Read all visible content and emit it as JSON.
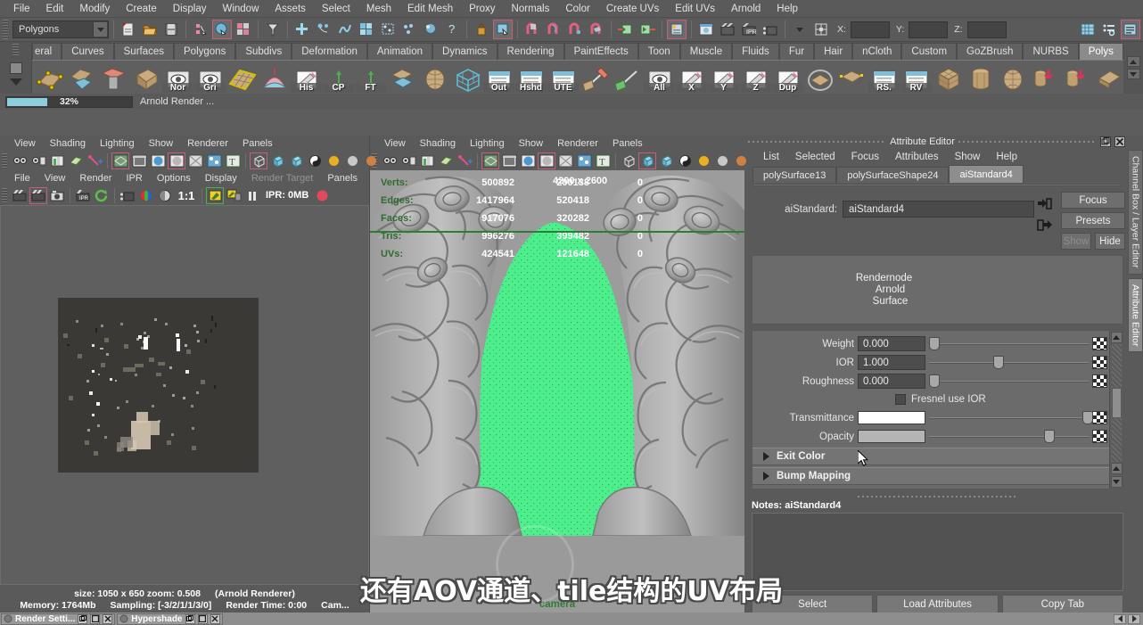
{
  "menubar": {
    "items": [
      "File",
      "Edit",
      "Modify",
      "Create",
      "Display",
      "Window",
      "Assets",
      "Select",
      "Mesh",
      "Edit Mesh",
      "Proxy",
      "Normals",
      "Color",
      "Create UVs",
      "Edit UVs",
      "Arnold",
      "Help"
    ]
  },
  "statusline": {
    "menuset": "Polygons",
    "coord_labels": [
      "X:",
      "Y:",
      "Z:"
    ],
    "coord_values": [
      "",
      "",
      ""
    ],
    "icons": [
      "new-scene-icon",
      "open-scene-icon",
      "save-scene-icon",
      "select-by-hierarchy-icon",
      "select-by-object-icon",
      "select-by-component-icon",
      "select-mask-icon",
      "snap-grid-icon",
      "snap-curve-icon",
      "snap-point-icon",
      "snap-view-plane-icon",
      "snap-projected-icon",
      "construction-plane-icon",
      "question-icon",
      "lock-icon",
      "highlight-selection-icon",
      "magnet-grid-icon",
      "magnet-curve-icon",
      "magnet-point-icon",
      "magnet-plane-icon",
      "input-connection-icon",
      "output-connection-icon",
      "render-attributes-icon",
      "render-view-icon",
      "render-sequence-icon",
      "ipr-render-icon",
      "render-settings-icon",
      "selection-mask-icon",
      "channel-box-icon",
      "attribute-editor-icon",
      "tool-settings-icon"
    ]
  },
  "shelf": {
    "tabs": [
      "eral",
      "Curves",
      "Surfaces",
      "Polygons",
      "Subdivs",
      "Deformation",
      "Animation",
      "Dynamics",
      "Rendering",
      "PaintEffects",
      "Toon",
      "Muscle",
      "Fluids",
      "Fur",
      "Hair",
      "nCloth",
      "Custom",
      "GoZBrush",
      "NURBS",
      "Polys"
    ],
    "active_tab": "Polys",
    "buttons": [
      {
        "label": "",
        "icon": "poly-plane-icon"
      },
      {
        "label": "",
        "icon": "poly-cube-split-icon"
      },
      {
        "label": "",
        "icon": "poly-delete-icon"
      },
      {
        "label": "",
        "icon": "poly-extrude-icon"
      },
      {
        "label": "Nor",
        "icon": "normals-icon"
      },
      {
        "label": "Gri",
        "icon": "grid-icon"
      },
      {
        "label": "",
        "icon": "poly-grid-plane-icon"
      },
      {
        "label": "",
        "icon": "soft-select-icon"
      },
      {
        "label": "His",
        "icon": "history-icon"
      },
      {
        "label": "CP",
        "icon": "center-pivot-icon"
      },
      {
        "label": "FT",
        "icon": "freeze-transform-icon"
      },
      {
        "label": "",
        "icon": "poly-quad-icon"
      },
      {
        "label": "",
        "icon": "poly-sphere-icon"
      },
      {
        "label": "",
        "icon": "wireframe-cube-icon"
      },
      {
        "label": "Out",
        "icon": "outliner-icon"
      },
      {
        "label": "Hshd",
        "icon": "hypershade-icon"
      },
      {
        "label": "UTE",
        "icon": "uv-texture-editor-icon"
      },
      {
        "label": "",
        "icon": "paint-weights-icon"
      },
      {
        "label": "",
        "icon": "mirror-axis-icon"
      },
      {
        "label": "All",
        "icon": "view-all-icon"
      },
      {
        "label": "X",
        "icon": "axis-x-icon"
      },
      {
        "label": "Y",
        "icon": "axis-y-icon"
      },
      {
        "label": "Z",
        "icon": "axis-z-icon"
      },
      {
        "label": "Dup",
        "icon": "duplicate-icon"
      },
      {
        "label": "",
        "icon": "poly-smooth-icon"
      },
      {
        "label": "",
        "icon": "poly-combine-icon"
      },
      {
        "label": "RS.",
        "icon": "render-settings-shelf-icon"
      },
      {
        "label": "RV",
        "icon": "render-view-shelf-icon"
      },
      {
        "label": "",
        "icon": "poly-cube-icon"
      },
      {
        "label": "",
        "icon": "poly-cylinder-icon"
      },
      {
        "label": "",
        "icon": "poly-sphere2-icon"
      },
      {
        "label": "",
        "icon": "poly-boolean-union-icon"
      },
      {
        "label": "",
        "icon": "poly-boolean-diff-icon"
      },
      {
        "label": "",
        "icon": "poly-bevel-icon"
      },
      {
        "label": "",
        "icon": "poly-subdivide-icon"
      },
      {
        "label": "",
        "icon": "poly-transform-icon"
      }
    ]
  },
  "progress": {
    "percent_label": "32%",
    "percent_value": 32,
    "status_text": "Arnold Render ..."
  },
  "render_view": {
    "panel_menus": [
      "File",
      "View",
      "Render",
      "IPR",
      "Options",
      "Display",
      "Render Target",
      "Panels"
    ],
    "disabled_menu": "Render Target",
    "toolbar_icons": [
      "render-current-frame-icon",
      "render-region-icon",
      "snapshot-icon",
      "ipr-render-icon",
      "refresh-render-icon",
      "render-sequence-icon",
      "rgb-channel-icon",
      "alpha-channel-icon",
      "ratio-1-1-icon",
      "keep-image-icon",
      "remove-image-icon",
      "pause-ipr-icon",
      "ipr-memory-indicator"
    ],
    "ipr_label": "IPR: 0MB",
    "ratio_label": "1:1",
    "status_line1": [
      "size: 1050 x 650 zoom: 0.508",
      "(Arnold Renderer)"
    ],
    "status_line2": [
      "Memory: 1764Mb",
      "Sampling: [-3/2/1/1/3/0]",
      "Render Time: 0:00",
      "Cam..."
    ]
  },
  "viewport": {
    "panel_menus": [
      "View",
      "Shading",
      "Lighting",
      "Show",
      "Renderer",
      "Panels"
    ],
    "toolbar_icons": [
      "select-camera-icon",
      "camera-attributes-icon",
      "bookmark-icon",
      "image-plane-icon",
      "paint-effects-icon",
      "grid-toggle-icon",
      "film-gate-icon",
      "resolution-gate-icon",
      "gate-mask-icon",
      "xray-icon",
      "xray-joints-icon",
      "texture-toggle-icon",
      "wireframe-icon",
      "smooth-shade-icon",
      "flat-shade-icon",
      "hw-texture-icon",
      "light-toggle-icon",
      "shadow-toggle-icon",
      "ao-toggle-icon"
    ],
    "hud": {
      "headers": [
        "",
        "",
        ""
      ],
      "rows": [
        {
          "label": "Verts:",
          "c1": "500892",
          "c2": "200138",
          "c3": "0"
        },
        {
          "label": "Edges:",
          "c1": "1417964",
          "c2": "520418",
          "c3": "0"
        },
        {
          "label": "Faces:",
          "c1": "917076",
          "c2": "320282",
          "c3": "0"
        },
        {
          "label": "Tris:",
          "c1": "996276",
          "c2": "399482",
          "c3": "0"
        },
        {
          "label": "UVs:",
          "c1": "424541",
          "c2": "121648",
          "c3": "0"
        }
      ],
      "resolution": "4200 x 2600"
    },
    "camera_label": "camera"
  },
  "attribute_editor": {
    "window_title": "Attribute Editor",
    "menus": [
      "List",
      "Selected",
      "Focus",
      "Attributes",
      "Show",
      "Help"
    ],
    "tabs": [
      "polySurface13",
      "polySurfaceShape24",
      "aiStandard4"
    ],
    "active_tab": "aiStandard4",
    "node_type_label": "aiStandard:",
    "node_name": "aiStandard4",
    "side_buttons": [
      "Focus",
      "Presets",
      "Show",
      "Hide"
    ],
    "node_info": [
      "Rendernode",
      "Arnold",
      "Surface"
    ],
    "attributes": [
      {
        "name": "Weight",
        "value": "0.000",
        "knob_pct": 0,
        "type": "numeric"
      },
      {
        "name": "IOR",
        "value": "1.000",
        "knob_pct": 40,
        "type": "numeric"
      },
      {
        "name": "Roughness",
        "value": "0.000",
        "knob_pct": 0,
        "type": "numeric"
      },
      {
        "name": "Transmittance",
        "value": "",
        "knob_pct": 96,
        "type": "color",
        "swatch": "#ffffff"
      },
      {
        "name": "Opacity",
        "value": "",
        "knob_pct": 72,
        "type": "color",
        "swatch": "#b4b4b4"
      }
    ],
    "checkbox_label": "Fresnel use IOR",
    "checkbox_checked": false,
    "collapsed_sections": [
      "Exit Color",
      "Bump Mapping"
    ],
    "notes_label": "Notes: aiStandard4",
    "notes_value": "",
    "bottom_buttons": [
      "Select",
      "Load Attributes",
      "Copy Tab"
    ],
    "vertical_tabs": [
      "Channel Box / Layer Editor",
      "Attribute Editor"
    ],
    "active_vertical_tab": "Attribute Editor"
  },
  "taskbar": {
    "windows": [
      "Render Setti...",
      "Hypershade"
    ]
  },
  "subtitle": {
    "text": "还有AOV通道、tile结构的UV布局"
  },
  "colors": {
    "bg": "#5a5a5a",
    "accent_progress": "#8ecede",
    "hud_green": "#2f6b2f",
    "selection_green": "#4dee8c",
    "tab_active": "#8d8d8d"
  }
}
